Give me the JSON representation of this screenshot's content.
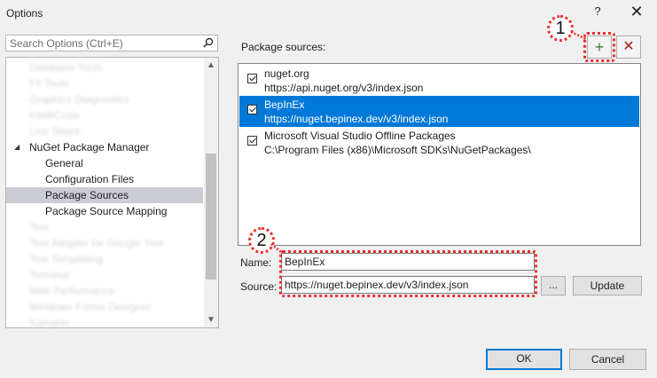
{
  "window": {
    "title": "Options",
    "help": "?",
    "close": "✕"
  },
  "search": {
    "placeholder": "Search Options (Ctrl+E)"
  },
  "tree": {
    "blurred_top": [
      "Database Tools",
      "F# Tools",
      "Graphics Diagnostics",
      "IntelliCode",
      "Live Share"
    ],
    "nuget_label": "NuGet Package Manager",
    "children": [
      "General",
      "Configuration Files",
      "Package Sources",
      "Package Source Mapping"
    ],
    "selected": "Package Sources",
    "blurred_bottom": [
      "Test",
      "Test Adapter for Google Test",
      "Text Templating",
      "Terminal",
      "Web Performance",
      "Windows Forms Designer",
      "Xamarin"
    ]
  },
  "sources_label": "Package sources:",
  "sources": [
    {
      "name": "nuget.org",
      "url": "https://api.nuget.org/v3/index.json",
      "checked": true,
      "selected": false
    },
    {
      "name": "BepInEx",
      "url": "https://nuget.bepinex.dev/v3/index.json",
      "checked": true,
      "selected": true
    },
    {
      "name": "Microsoft Visual Studio Offline Packages",
      "url": "C:\\Program Files (x86)\\Microsoft SDKs\\NuGetPackages\\",
      "checked": true,
      "selected": false
    }
  ],
  "form": {
    "name_label": "Name:",
    "name_value": "BepInEx",
    "source_label": "Source:",
    "source_value": "https://nuget.bepinex.dev/v3/index.json",
    "browse_label": "...",
    "update_label": "Update"
  },
  "buttons": {
    "add": "+",
    "remove": "✕",
    "ok": "OK",
    "cancel": "Cancel"
  },
  "annotations": {
    "callout_1": "1",
    "callout_2": "2",
    "color": "#e8322f"
  }
}
